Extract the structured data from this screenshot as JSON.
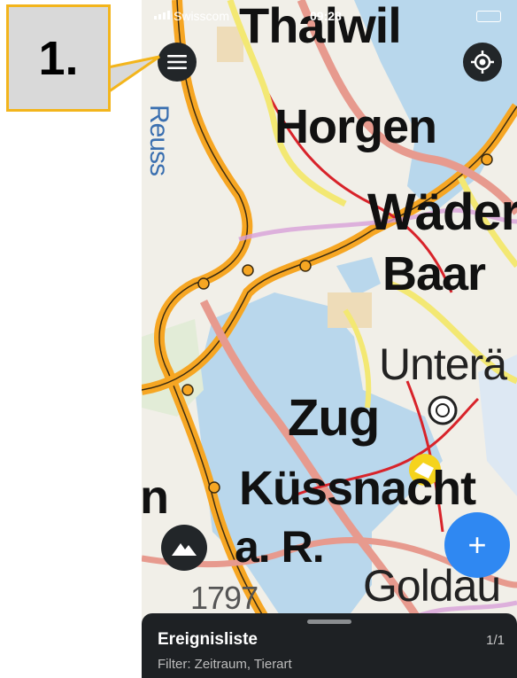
{
  "status_bar": {
    "carrier": "Swisscom",
    "time": "09:28"
  },
  "map": {
    "labels": {
      "thalwil": "Thalwil",
      "reuss": "Reuss",
      "horgen": "Horgen",
      "waeden": "Wäder",
      "baar": "Baar",
      "unterae": "Unterä",
      "zug": "Zug",
      "kuessnacht": "Küssnacht",
      "ar": "a. R.",
      "goldau": "Goldau",
      "n": "n",
      "elev": "1797"
    }
  },
  "buttons": {
    "menu_icon": "menu-icon",
    "locate_icon": "locate-icon",
    "terrain_icon": "terrain-icon",
    "add_label": "+"
  },
  "event_list": {
    "title": "Ereignisliste",
    "count": "1/1",
    "filter": "Filter: Zeitraum, Tierart"
  },
  "callout": {
    "step": "1."
  },
  "colors": {
    "accent": "#2f88f2",
    "callout_border": "#f3b51c",
    "sheet": "#1e2124"
  }
}
